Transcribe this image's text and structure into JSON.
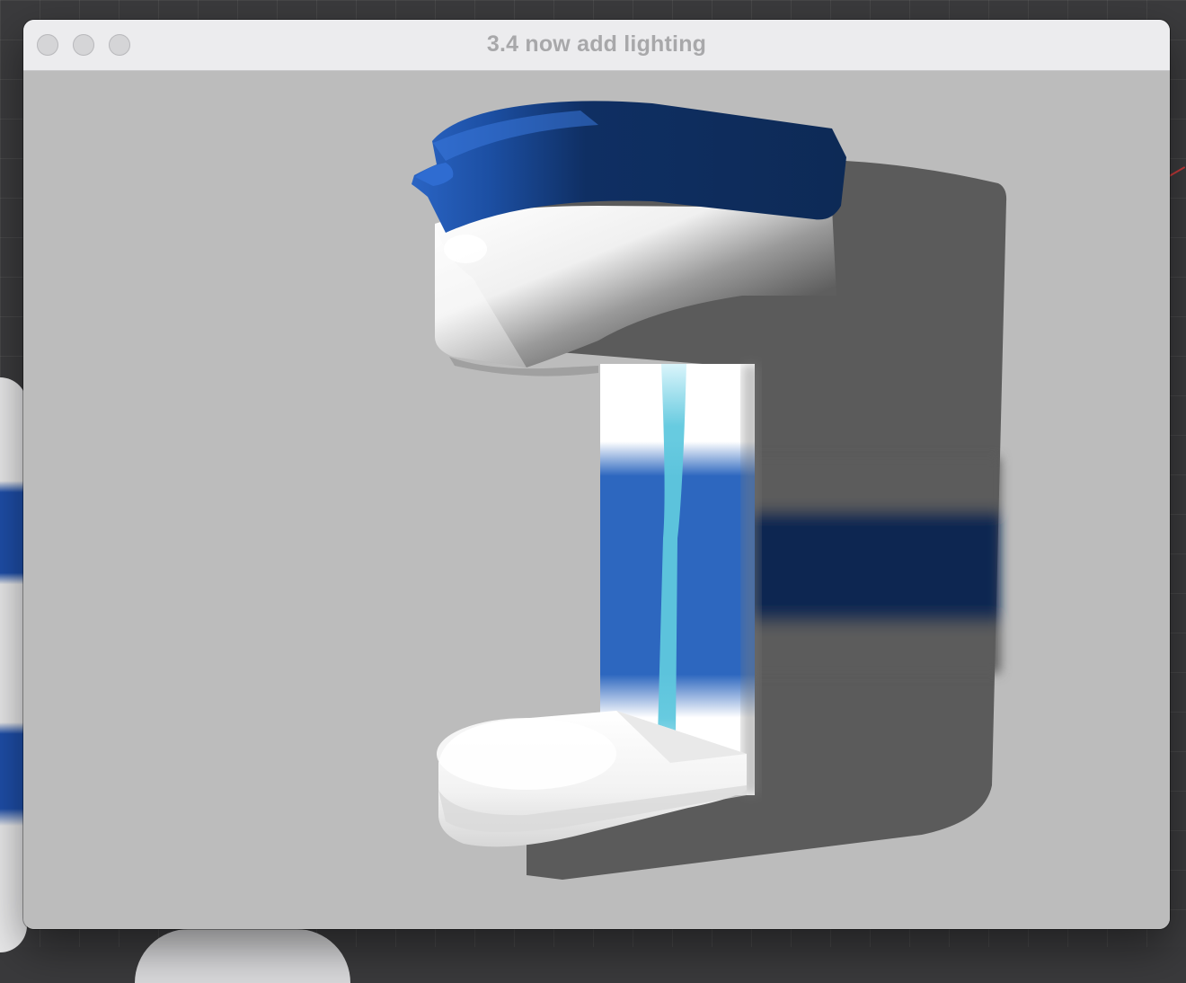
{
  "window": {
    "title": "3.4 now add lighting",
    "controls": [
      "close",
      "minimize",
      "zoom"
    ]
  },
  "scene": {
    "object": "coffee-maker",
    "colors": {
      "background": "#bcbcbc",
      "lid_blue": "#0d2a56",
      "lid_highlight": "#2a64c4",
      "band_blue": "#2d67bf",
      "band_dark": "#0c2651",
      "water_cyan": "#5fc8de",
      "shadow_grey": "#5b5b5b",
      "body_white": "#f5f5f5"
    }
  }
}
